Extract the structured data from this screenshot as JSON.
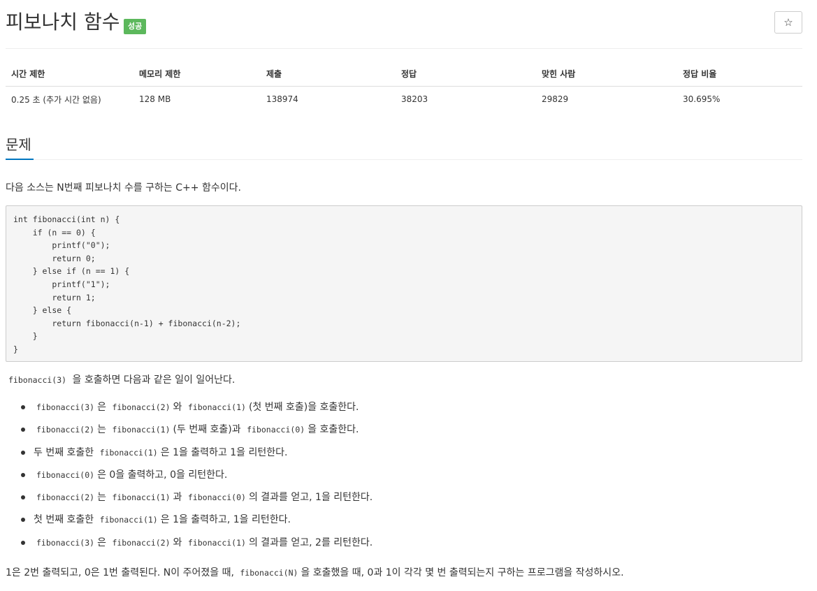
{
  "problem": {
    "title": "피보나치 함수",
    "status_badge": "성공",
    "star_icon": "☆"
  },
  "stats": {
    "headers": [
      "시간 제한",
      "메모리 제한",
      "제출",
      "정답",
      "맞힌 사람",
      "정답 비율"
    ],
    "values": [
      "0.25 초 (추가 시간 없음)",
      "128 MB",
      "138974",
      "38203",
      "29829",
      "30.695%"
    ]
  },
  "section": {
    "heading": "문제"
  },
  "description": {
    "intro": "다음 소스는 N번째 피보나치 수를 구하는 C++ 함수이다.",
    "code": "int fibonacci(int n) {\n    if (n == 0) {\n        printf(\"0\");\n        return 0;\n    } else if (n == 1) {\n        printf(\"1\");\n        return 1;\n    } else {\n        return fibonacci(n-1) + fibonacci(n-2);\n    }\n}",
    "call_line": {
      "code": "fibonacci(3)",
      "text": "을 호출하면 다음과 같은 일이 일어난다."
    },
    "bullets": [
      {
        "c1": "fibonacci(3)",
        "t1": "은",
        "c2": "fibonacci(2)",
        "t2": "와",
        "c3": "fibonacci(1)",
        "t3": "(첫 번째 호출)을 호출한다."
      },
      {
        "c1": "fibonacci(2)",
        "t1": "는",
        "c2": "fibonacci(1)",
        "t2": "(두 번째 호출)과",
        "c3": "fibonacci(0)",
        "t3": "을 호출한다."
      },
      {
        "t0": "두 번째 호출한",
        "c1": "fibonacci(1)",
        "t1": "은 1을 출력하고 1을 리턴한다."
      },
      {
        "c1": "fibonacci(0)",
        "t1": "은 0을 출력하고, 0을 리턴한다."
      },
      {
        "c1": "fibonacci(2)",
        "t1": "는",
        "c2": "fibonacci(1)",
        "t2": "과",
        "c3": "fibonacci(0)",
        "t3": "의 결과를 얻고, 1을 리턴한다."
      },
      {
        "t0": "첫 번째 호출한",
        "c1": "fibonacci(1)",
        "t1": "은 1을 출력하고, 1을 리턴한다."
      },
      {
        "c1": "fibonacci(3)",
        "t1": "은",
        "c2": "fibonacci(2)",
        "t2": "와",
        "c3": "fibonacci(1)",
        "t3": "의 결과를 얻고, 2를 리턴한다."
      }
    ],
    "final": {
      "t1": "1은 2번 출력되고, 0은 1번 출력된다. N이 주어졌을 때,",
      "code": "fibonacci(N)",
      "t2": "을 호출했을 때, 0과 1이 각각 몇 번 출력되는지 구하는 프로그램을 작성하시오."
    }
  },
  "colors": {
    "badge": "#5cb85c",
    "accent": "#0076c0",
    "code_bg": "#f5f5f5"
  }
}
